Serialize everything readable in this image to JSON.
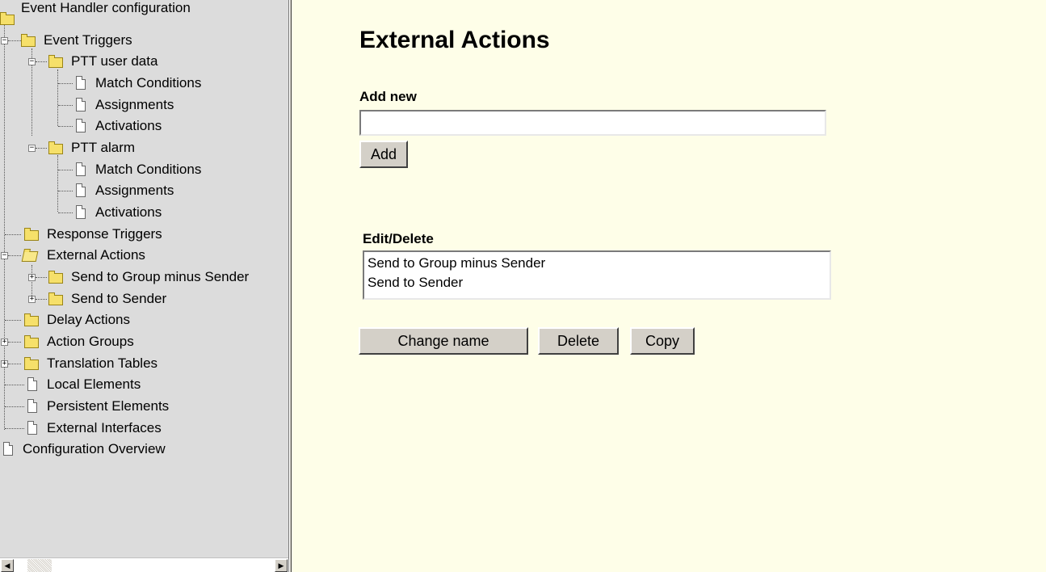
{
  "tree": {
    "items": [
      {
        "label": "Event Handler configuration"
      },
      {
        "label": "Event Triggers"
      },
      {
        "label": "PTT user data"
      },
      {
        "label": "Match Conditions"
      },
      {
        "label": "Assignments"
      },
      {
        "label": "Activations"
      },
      {
        "label": "PTT alarm"
      },
      {
        "label": "Match Conditions"
      },
      {
        "label": "Assignments"
      },
      {
        "label": "Activations"
      },
      {
        "label": "Response Triggers"
      },
      {
        "label": "External Actions"
      },
      {
        "label": "Send to Group minus Sender"
      },
      {
        "label": "Send to Sender"
      },
      {
        "label": "Delay Actions"
      },
      {
        "label": "Action Groups"
      },
      {
        "label": "Translation Tables"
      },
      {
        "label": "Local Elements"
      },
      {
        "label": "Persistent Elements"
      },
      {
        "label": "External Interfaces"
      },
      {
        "label": "Configuration Overview"
      }
    ]
  },
  "scrollbar": {
    "left_arrow": "◀",
    "right_arrow": "▶"
  },
  "main": {
    "title": "External Actions",
    "add_new_label": "Add new",
    "add_input_value": "",
    "add_button": "Add",
    "edit_delete_label": "Edit/Delete",
    "list_options": [
      "Send to Group minus Sender",
      "Send to Sender"
    ],
    "change_name_button": "Change name",
    "delete_button": "Delete",
    "copy_button": "Copy"
  },
  "colors": {
    "tree_background": "#dcdcdc",
    "content_background": "#fefee8",
    "folder": "#f6e06a",
    "button_face": "#d4d0c8"
  }
}
